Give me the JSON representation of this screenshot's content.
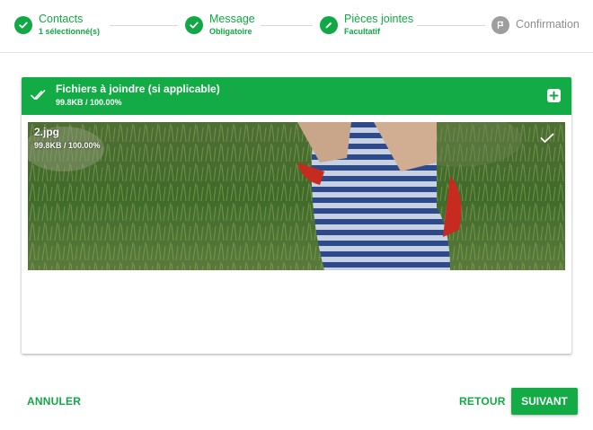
{
  "colors": {
    "accent": "#12ab45",
    "inactive": "#9e9e9e"
  },
  "stepper": {
    "steps": [
      {
        "title": "Contacts",
        "subtitle": "1 sélectionné(s)",
        "state": "done",
        "icon": "check-icon"
      },
      {
        "title": "Message",
        "subtitle": "Obligatoire",
        "state": "done",
        "icon": "check-icon"
      },
      {
        "title": "Pièces jointes",
        "subtitle": "Facultatif",
        "state": "edit",
        "icon": "pencil-icon"
      },
      {
        "title": "Confirmation",
        "subtitle": "",
        "state": "pending",
        "icon": "flag-icon"
      }
    ]
  },
  "attachments": {
    "title": "Fichiers à joindre (si applicable)",
    "progress": "99.8KB / 100.00%",
    "header_icon": "double-check-icon",
    "add_icon": "plus-square-icon",
    "files": [
      {
        "name": "2.jpg",
        "progress": "99.8KB / 100.00%",
        "status_icon": "check-icon"
      }
    ]
  },
  "footer": {
    "cancel_label": "ANNULER",
    "back_label": "RETOUR",
    "next_label": "SUIVANT"
  }
}
